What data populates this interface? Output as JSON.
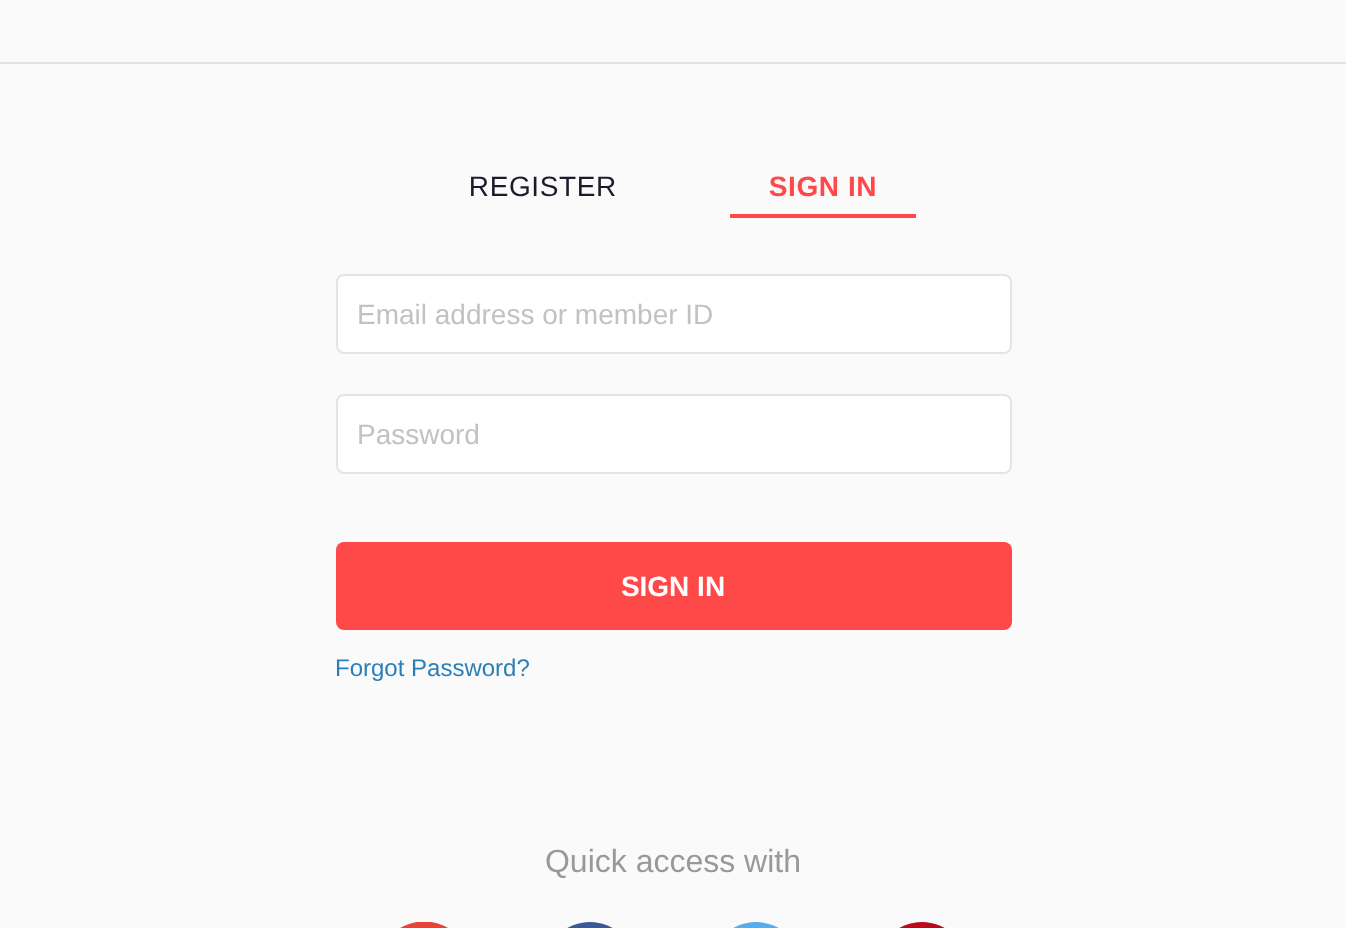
{
  "tabs": [
    {
      "label": "REGISTER",
      "selected": false
    },
    {
      "label": "SIGN IN",
      "selected": true
    }
  ],
  "email": {
    "placeholder": "Email address or member ID"
  },
  "password": {
    "placeholder": "Password"
  },
  "submit": "SIGN IN",
  "forgot_link": "Forgot Password?",
  "quick_access": {
    "title": "Quick access with",
    "providers": [
      {
        "kind": "google"
      },
      {
        "kind": "facebook"
      },
      {
        "kind": "twitter"
      },
      {
        "kind": "pinterest"
      }
    ]
  }
}
